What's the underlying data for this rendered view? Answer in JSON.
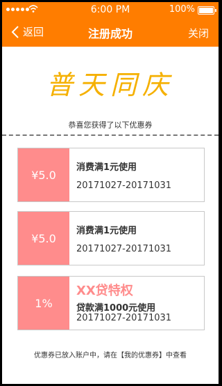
{
  "status_bar": {
    "time": "6:00 PM",
    "battery": "100%"
  },
  "nav": {
    "back_label": "返回",
    "title": "注册成功",
    "close_label": "关闭"
  },
  "brand": {
    "logo_text": "普天同庆"
  },
  "congrats_text": "恭喜您获得了以下优惠券",
  "coupons": [
    {
      "amount": "¥5.0",
      "condition": "消费满1元使用",
      "date_range": "20171027-20171031"
    },
    {
      "amount": "¥5.0",
      "condition": "消费满1元使用",
      "date_range": "20171027-20171031"
    },
    {
      "amount": "1%",
      "special_title": "XX贷特权",
      "condition": "贷款满1000元使用",
      "date_range": "20171027-20171031"
    }
  ],
  "footer_text": "优惠券已放入账户中，请在【我的优惠券】中查看",
  "colors": {
    "header": "#ff7d00",
    "coupon_accent": "#ff8c8c",
    "logo": "#f5b000"
  }
}
